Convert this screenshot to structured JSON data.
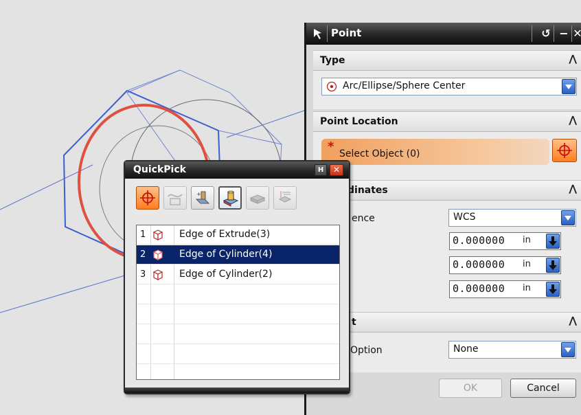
{
  "point_dialog": {
    "title": "Point",
    "type_section": {
      "header": "Type",
      "selected_type": "Arc/Ellipse/Sphere Center"
    },
    "location_section": {
      "header": "Point Location",
      "asterisk": "*",
      "select_label": "Select Object (0)"
    },
    "coordinates_section": {
      "header": "dinates",
      "reference_label": "ence",
      "reference_value": "WCS",
      "fields": [
        {
          "value": "0.000000",
          "unit": "in"
        },
        {
          "value": "0.000000",
          "unit": "in"
        },
        {
          "value": "0.000000",
          "unit": "in"
        }
      ]
    },
    "offset_section": {
      "header": "t",
      "option_label": "t Option",
      "option_value": "None"
    },
    "buttons": {
      "ok": "OK",
      "cancel": "Cancel"
    }
  },
  "quickpick": {
    "title": "QuickPick",
    "rows": [
      {
        "num": "1",
        "text": "Edge of Extrude(3)",
        "selected": false
      },
      {
        "num": "2",
        "text": "Edge of Cylinder(4)",
        "selected": true
      },
      {
        "num": "3",
        "text": "Edge of Cylinder(2)",
        "selected": false
      }
    ]
  },
  "colors": {
    "accent_orange": "#ff8c2a",
    "selection_blue": "#0a246a",
    "highlight_red": "#e05040",
    "wire_blue": "#3b63d0"
  }
}
